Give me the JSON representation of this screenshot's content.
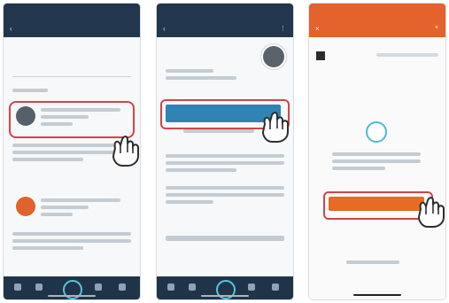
{
  "screens": [
    {
      "id": "search",
      "theme": "#22364d",
      "bottom_nav": true
    },
    {
      "id": "skill-detail",
      "theme": "#22364d",
      "bottom_nav": true
    },
    {
      "id": "account-linking",
      "theme": "#e4622b",
      "bottom_nav": false
    }
  ],
  "icons": {
    "pointer": "pointing-hand-icon",
    "alexa": "alexa-ring-icon"
  },
  "colors": {
    "highlight": "#d3434a",
    "dark_header": "#22364d",
    "orange_header": "#e4622b",
    "button_blue": "#2f83b5",
    "button_orange": "#e66b23"
  }
}
